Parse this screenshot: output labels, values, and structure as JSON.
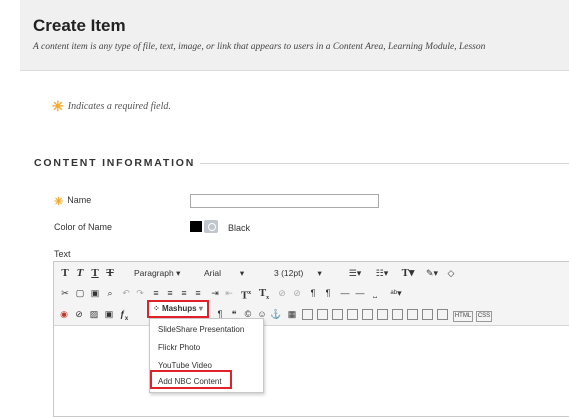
{
  "header": {
    "title": "Create Item",
    "description": "A content item is any type of file, text, image, or link that appears to users in a Content Area, Learning Module, Lesson"
  },
  "required_note": "Indicates a required field.",
  "section": {
    "title": "CONTENT INFORMATION"
  },
  "fields": {
    "name_label": "Name",
    "name_value": "",
    "color_label": "Color of Name",
    "color_value": "Black",
    "text_label": "Text"
  },
  "toolbar": {
    "row1": {
      "buttons": [
        "T",
        "T",
        "T",
        "T"
      ],
      "format_select": "Paragraph",
      "font_select": "Arial",
      "size_select": "3 (12pt)"
    },
    "row3": {
      "mashups_label": "Mashups",
      "html_label": "HTML",
      "css_label": "CSS"
    }
  },
  "mashups_menu": {
    "items": [
      "SlideShare Presentation",
      "Flickr Photo",
      "YouTube Video",
      "Add NBC Content"
    ]
  },
  "colors": {
    "highlight": "#e0222b",
    "required_star": "#f5a623"
  }
}
